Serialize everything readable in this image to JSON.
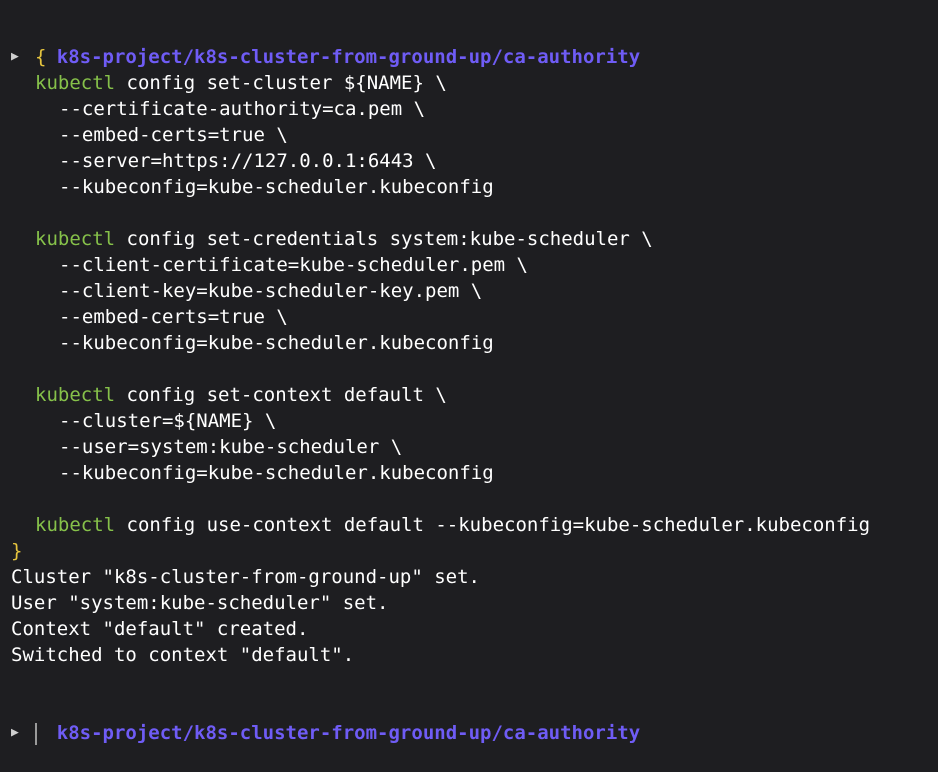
{
  "prompt_path": "k8s-project/k8s-cluster-from-ground-up/ca-authority",
  "prompt_arrow": "▶",
  "open_brace": "{",
  "close_brace": "}",
  "kubectl": "kubectl",
  "cmd1": {
    "main": " config set-cluster ${NAME} \\",
    "args": [
      "--certificate-authority=ca.pem \\",
      "--embed-certs=true \\",
      "--server=https://127.0.0.1:6443 \\",
      "--kubeconfig=kube-scheduler.kubeconfig"
    ]
  },
  "cmd2": {
    "main": " config set-credentials system:kube-scheduler \\",
    "args": [
      "--client-certificate=kube-scheduler.pem \\",
      "--client-key=kube-scheduler-key.pem \\",
      "--embed-certs=true \\",
      "--kubeconfig=kube-scheduler.kubeconfig"
    ]
  },
  "cmd3": {
    "main": " config set-context default \\",
    "args": [
      "--cluster=${NAME} \\",
      "--user=system:kube-scheduler \\",
      "--kubeconfig=kube-scheduler.kubeconfig"
    ]
  },
  "cmd4": {
    "main": " config use-context default --kubeconfig=kube-scheduler.kubeconfig"
  },
  "output": [
    "Cluster \"k8s-cluster-from-ground-up\" set.",
    "User \"system:kube-scheduler\" set.",
    "Context \"default\" created.",
    "Switched to context \"default\"."
  ],
  "colors": {
    "background": "#1e1e21",
    "path": "#6f5cf5",
    "brace": "#e5c43e",
    "command": "#86c14a",
    "text": "#ffffff"
  }
}
